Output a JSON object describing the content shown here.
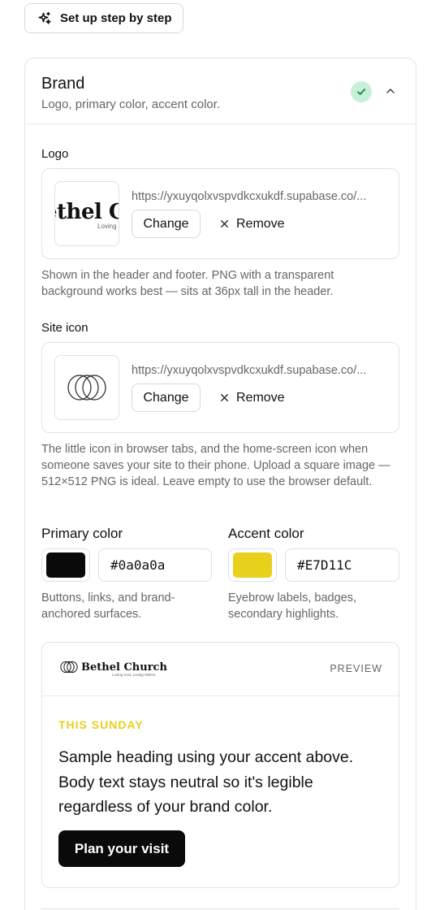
{
  "setup": {
    "label": "Set up step by step"
  },
  "brand": {
    "title": "Brand",
    "subtitle": "Logo, primary color, accent color.",
    "status_icon": "check-icon",
    "collapse_icon": "chevron-up-icon"
  },
  "logo": {
    "label": "Logo",
    "thumb_text": "ethel C",
    "thumb_tagline": "Loving",
    "url": "https://yxuyqolxvspvdkcxukdf.supabase.co/...",
    "change_label": "Change",
    "remove_label": "Remove",
    "help": "Shown in the header and footer. PNG with a transparent background works best — sits at 36px tall in the header."
  },
  "site_icon": {
    "label": "Site icon",
    "url": "https://yxuyqolxvspvdkcxukdf.supabase.co/...",
    "change_label": "Change",
    "remove_label": "Remove",
    "help": "The little icon in browser tabs, and the home-screen icon when someone saves your site to their phone. Upload a square image — 512×512 PNG is ideal. Leave empty to use the browser default."
  },
  "primary_color": {
    "label": "Primary color",
    "value": "#0a0a0a",
    "swatch": "#0a0a0a",
    "help": "Buttons, links, and brand-anchored surfaces."
  },
  "accent_color": {
    "label": "Accent color",
    "value": "#E7D11C",
    "swatch": "#E7D11C",
    "help": "Eyebrow labels, badges, secondary highlights."
  },
  "preview": {
    "logo_name": "Bethel Church",
    "logo_tagline": "Loving God. Loving Others.",
    "label": "PREVIEW",
    "eyebrow": "THIS SUNDAY",
    "heading": "Sample heading using your accent above. Body text stays neutral so it's legible regardless of your brand color.",
    "cta_label": "Plan your visit"
  }
}
